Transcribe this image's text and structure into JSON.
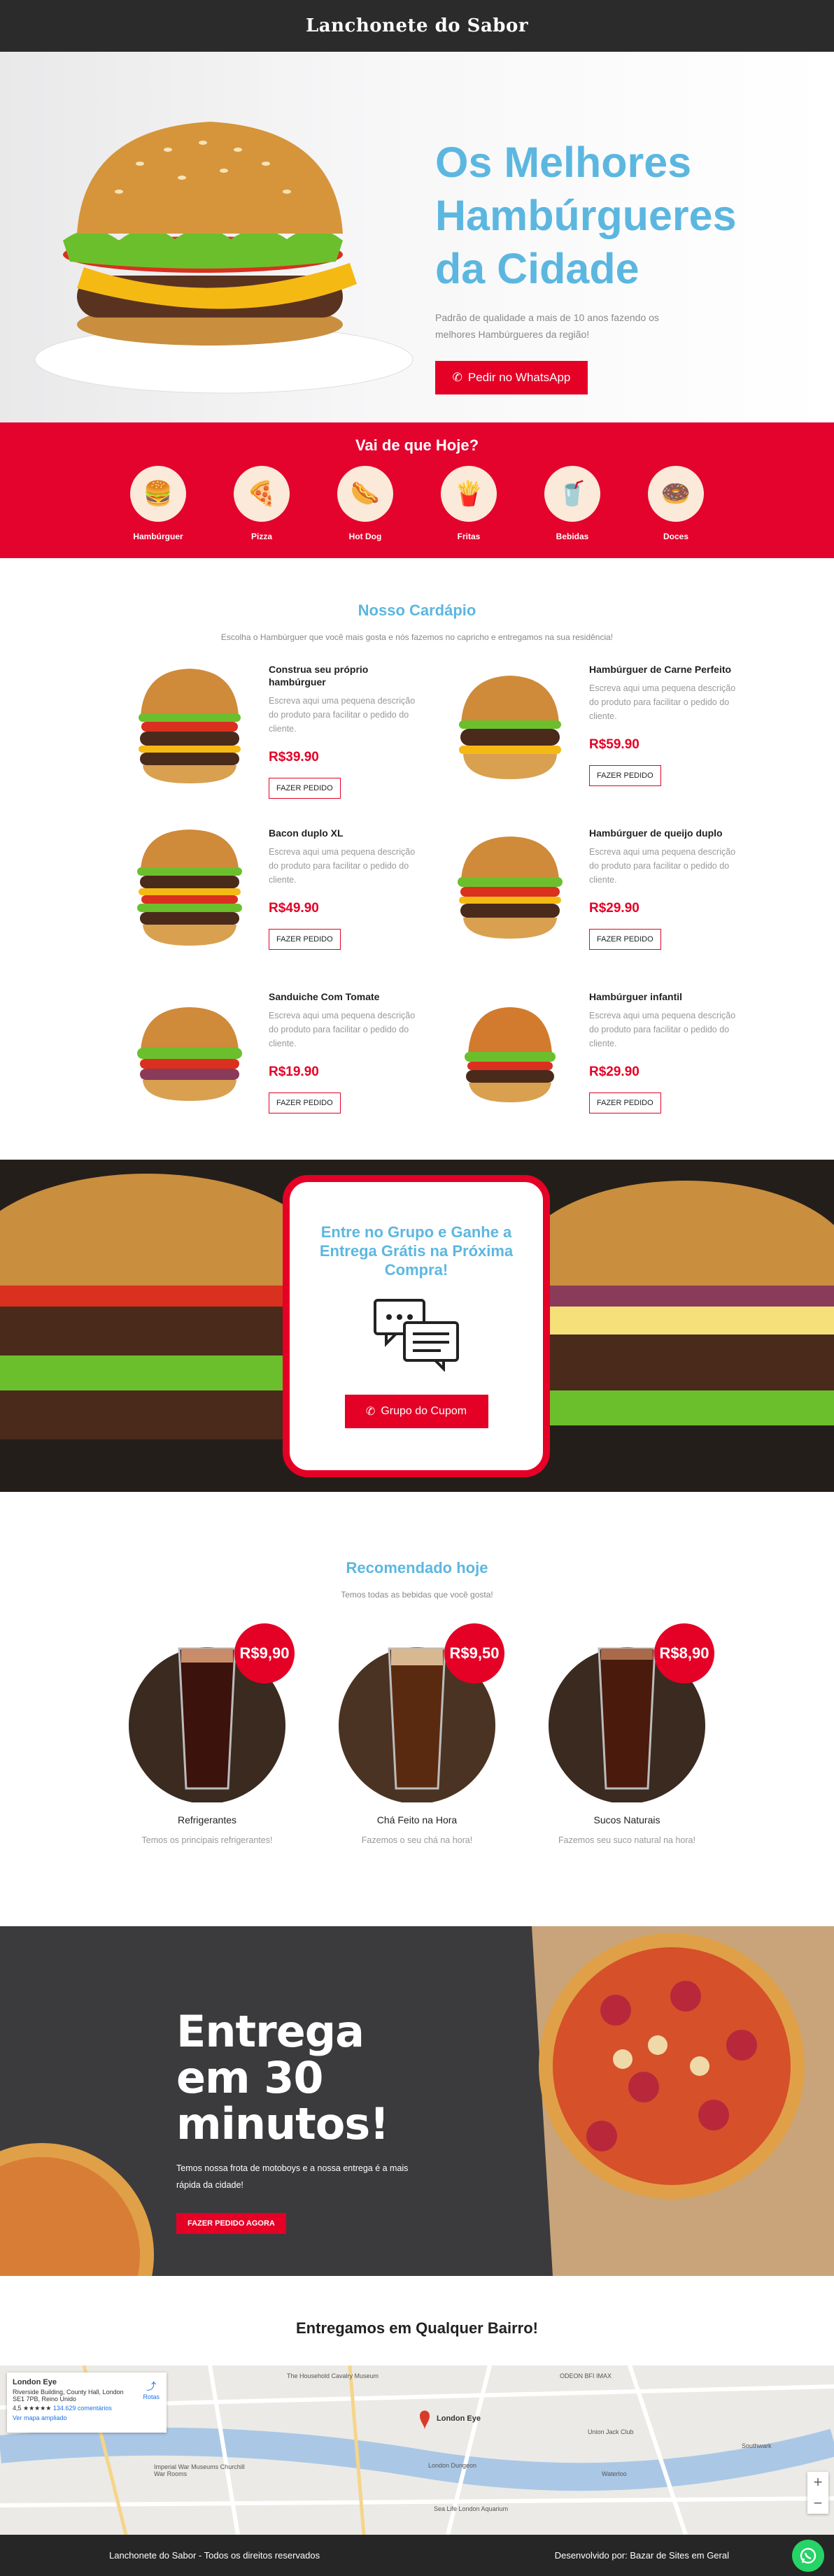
{
  "header": {
    "brand": "Lanchonete do Sabor"
  },
  "hero": {
    "title": "Os Melhores Hambúrgueres da Cidade",
    "subtitle": "Padrão de qualidade a mais de 10 anos fazendo os melhores Hambúrgueres da região!",
    "cta": "Pedir no WhatsApp"
  },
  "categories": {
    "title": "Vai de que Hoje?",
    "items": [
      {
        "label": "Hambúrguer",
        "icon": "burger-icon"
      },
      {
        "label": "Pizza",
        "icon": "pizza-icon"
      },
      {
        "label": "Hot Dog",
        "icon": "hotdog-icon"
      },
      {
        "label": "Fritas",
        "icon": "fries-icon"
      },
      {
        "label": "Bebidas",
        "icon": "drink-icon"
      },
      {
        "label": "Doces",
        "icon": "donut-icon"
      }
    ]
  },
  "menu": {
    "title": "Nosso Cardápio",
    "subtitle": "Escolha o Hambúrguer que você mais gosta e nós fazemos no capricho e entregamos na sua residência!",
    "items": [
      {
        "name": "Construa seu próprio hambúrguer",
        "desc": "Escreva aqui uma pequena descrição do produto para facilitar o pedido do cliente.",
        "price": "R$39.90",
        "button": "FAZER PEDIDO"
      },
      {
        "name": "Hambúrguer de Carne Perfeito",
        "desc": "Escreva aqui uma pequena descrição do produto para facilitar o pedido do cliente.",
        "price": "R$59.90",
        "button": "FAZER PEDIDO"
      },
      {
        "name": "Bacon duplo XL",
        "desc": "Escreva aqui uma pequena descrição do produto para facilitar o pedido do cliente.",
        "price": "R$49.90",
        "button": "FAZER PEDIDO"
      },
      {
        "name": "Hambúrguer de queijo duplo",
        "desc": "Escreva aqui uma pequena descrição do produto para facilitar o pedido do cliente.",
        "price": "R$29.90",
        "button": "FAZER PEDIDO"
      },
      {
        "name": "Sanduiche Com Tomate",
        "desc": "Escreva aqui uma pequena descrição do produto para facilitar o pedido do cliente.",
        "price": "R$19.90",
        "button": "FAZER PEDIDO"
      },
      {
        "name": "Hambúrguer infantil",
        "desc": "Escreva aqui uma pequena descrição do produto para facilitar o pedido do cliente.",
        "price": "R$29.90",
        "button": "FAZER PEDIDO"
      }
    ]
  },
  "coupon": {
    "title": "Entre no Grupo e Ganhe a Entrega Grátis na Próxima Compra!",
    "button": "Grupo do Cupom"
  },
  "drinks": {
    "title": "Recomendado hoje",
    "subtitle": "Temos todas as bebidas que você gosta!",
    "items": [
      {
        "name": "Refrigerantes",
        "desc": "Temos os principais refrigerantes!",
        "price": "R$9,90"
      },
      {
        "name": "Chá Feito na Hora",
        "desc": "Fazemos o seu chá na hora!",
        "price": "R$9,50"
      },
      {
        "name": "Sucos Naturais",
        "desc": "Fazemos seu suco natural na hora!",
        "price": "R$8,90"
      }
    ]
  },
  "delivery": {
    "title": "Entrega em 30 minutos!",
    "subtitle": "Temos nossa frota de motoboys e a nossa entrega é a mais rápida da cidade!",
    "button": "FAZER PEDIDO AGORA"
  },
  "map": {
    "title": "Entregamos em Qualquer Bairro!",
    "place_name": "London Eye",
    "place_address": "Riverside Building, County Hall, London SE1 7PB, Reino Unido",
    "rating": "4,5 ★★★★★",
    "reviews": "134.629 comentários",
    "larger_map": "Ver mapa ampliado",
    "route": "Rotas",
    "labels": [
      "The Household Cavalry Museum",
      "London Eye",
      "London Dungeon",
      "Imperial War Museums Churchill War Rooms",
      "Waterloo",
      "Sea Life London Aquarium",
      "ODEON BFI IMAX",
      "Union Jack Club",
      "Southwark"
    ]
  },
  "footer": {
    "left": "Lanchonete do Sabor  - Todos os direitos reservados",
    "right": "Desenvolvido por: Bazar de Sites em Geral"
  }
}
